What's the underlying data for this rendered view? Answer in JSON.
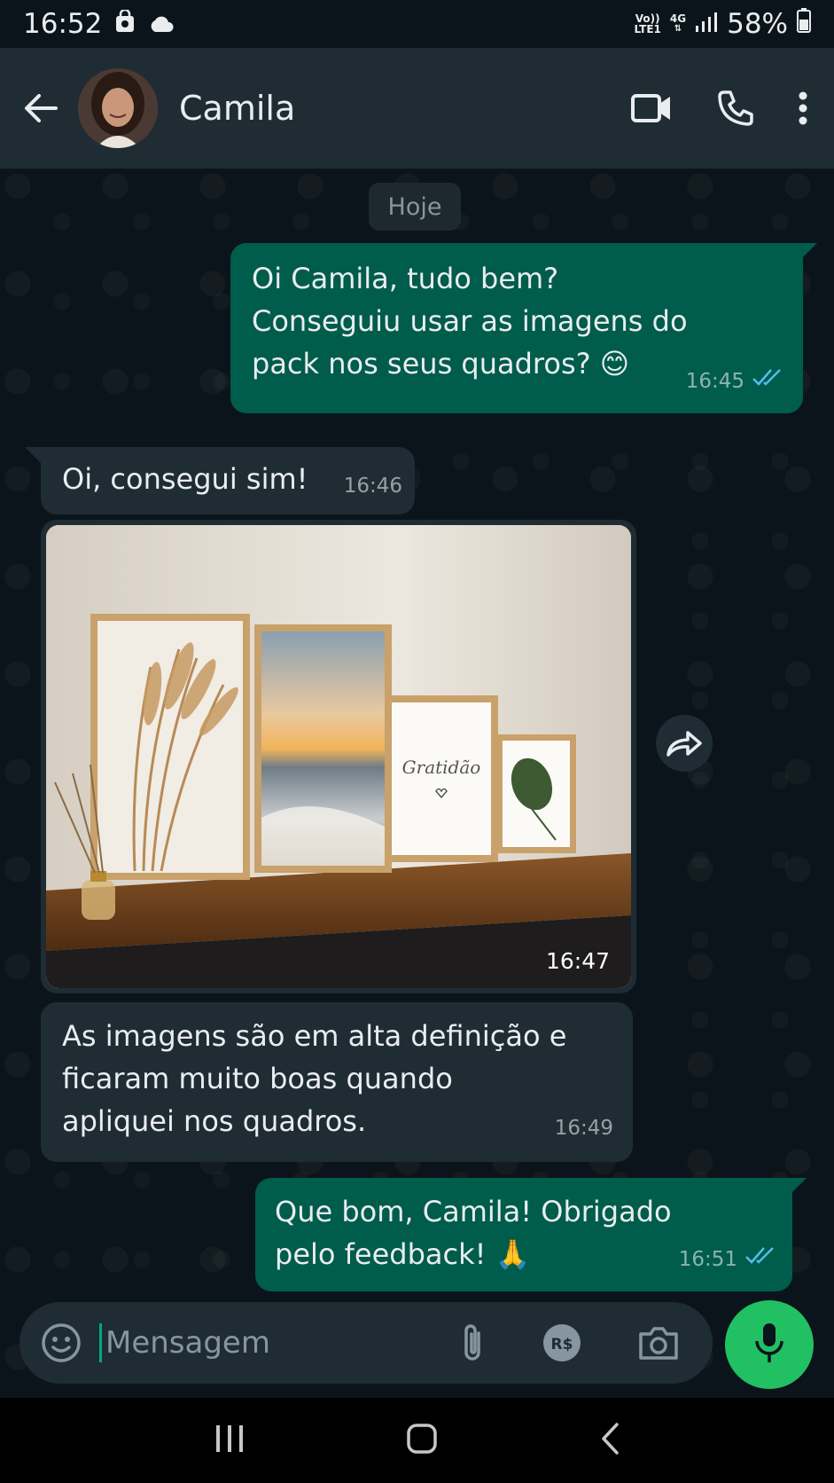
{
  "status_bar": {
    "time": "16:52",
    "volte_top": "Vo))",
    "volte_bottom": "LTE1",
    "network": "4G",
    "battery": "58%"
  },
  "header": {
    "contact_name": "Camila"
  },
  "chat": {
    "day_chip": "Hoje",
    "messages": [
      {
        "direction": "out",
        "text": "Oi Camila, tudo bem? Conseguiu usar as imagens do pack nos seus quadros? 😊",
        "time": "16:45",
        "status": "read"
      },
      {
        "direction": "in",
        "text": "Oi, consegui sim!",
        "time": "16:46"
      },
      {
        "direction": "in",
        "type": "image",
        "time": "16:47",
        "artwork_text": "Gratidão"
      },
      {
        "direction": "in",
        "text": "As imagens são em alta definição e ficaram muito boas quando apliquei nos quadros.",
        "time": "16:49"
      },
      {
        "direction": "out",
        "text": "Que bom, Camila! Obrigado pelo feedback! 🙏",
        "time": "16:51",
        "status": "read"
      }
    ]
  },
  "input": {
    "placeholder": "Mensagem"
  },
  "colors": {
    "outgoing_bubble": "#005c4b",
    "incoming_bubble": "#1f2c34",
    "read_ticks": "#53bdeb",
    "accent": "#21c063"
  },
  "icons": [
    "back-arrow-icon",
    "video-call-icon",
    "phone-icon",
    "more-vert-icon",
    "emoji-icon",
    "attach-icon",
    "payment-icon",
    "camera-icon",
    "mic-icon",
    "forward-icon",
    "read-receipt-icon"
  ]
}
